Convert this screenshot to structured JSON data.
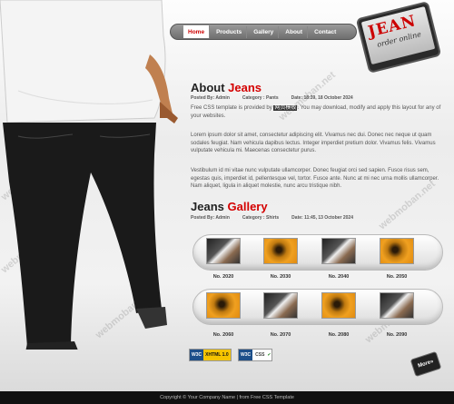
{
  "nav": {
    "items": [
      "Home",
      "Products",
      "Gallery",
      "About",
      "Contact"
    ],
    "active": "Home"
  },
  "logo": {
    "title": "JEAN",
    "subtitle": "order online"
  },
  "about": {
    "title_a": "About",
    "title_b": "Jeans",
    "posted": "Posted By: Admin",
    "category": "Category : Pants",
    "date": "Date: 18:39, 18 October 2024",
    "p1_a": "Free CSS template is provided by ",
    "p1_link": "网页模板",
    "p1_b": ". You may download, modify and apply this layout for any of your websites.",
    "p2": "Lorem ipsum dolor sit amet, consectetur adipiscing elit. Vivamus nec dui. Donec nec neque ut quam sodales feugiat. Nam vehicula dapibus lectus. Integer imperdiet pretium dolor. Vivamus felis. Vivamus vulputate vehicula mi. Maecenas consectetur purus.",
    "p3": "Vestibulum id mi vitae nunc vulputate ullamcorper. Donec feugiat orci sed sapien. Fusce risus sem, egestas quis, imperdiet id, pellentesque vel, tortor. Fusce ante. Nunc at mi nec urna mollis ullamcorper. Nam aliquet, ligula in aliquet molestie, nunc arcu tristique nibh."
  },
  "gallery": {
    "title_a": "Jeans",
    "title_b": "Gallery",
    "posted": "Posted By: Admin",
    "category": "Category : Shirts",
    "date": "Date: 11:45, 13 October 2024",
    "row1": [
      {
        "num": "No. 2020",
        "style": "dark"
      },
      {
        "num": "No. 2030",
        "style": "orange"
      },
      {
        "num": "No. 2040",
        "style": "dark"
      },
      {
        "num": "No. 2050",
        "style": "orange"
      }
    ],
    "row2": [
      {
        "num": "No. 2060",
        "style": "orange"
      },
      {
        "num": "No. 2070",
        "style": "dark"
      },
      {
        "num": "No. 2080",
        "style": "orange"
      },
      {
        "num": "No. 2090",
        "style": "dark"
      }
    ]
  },
  "badges": {
    "w3c": "W3C",
    "xhtml": "XHTML 1.0",
    "css": "CSS"
  },
  "more": "More»",
  "footer": "Copyright © Your Company Name | from Free CSS Template",
  "watermark": "webmoban.net"
}
